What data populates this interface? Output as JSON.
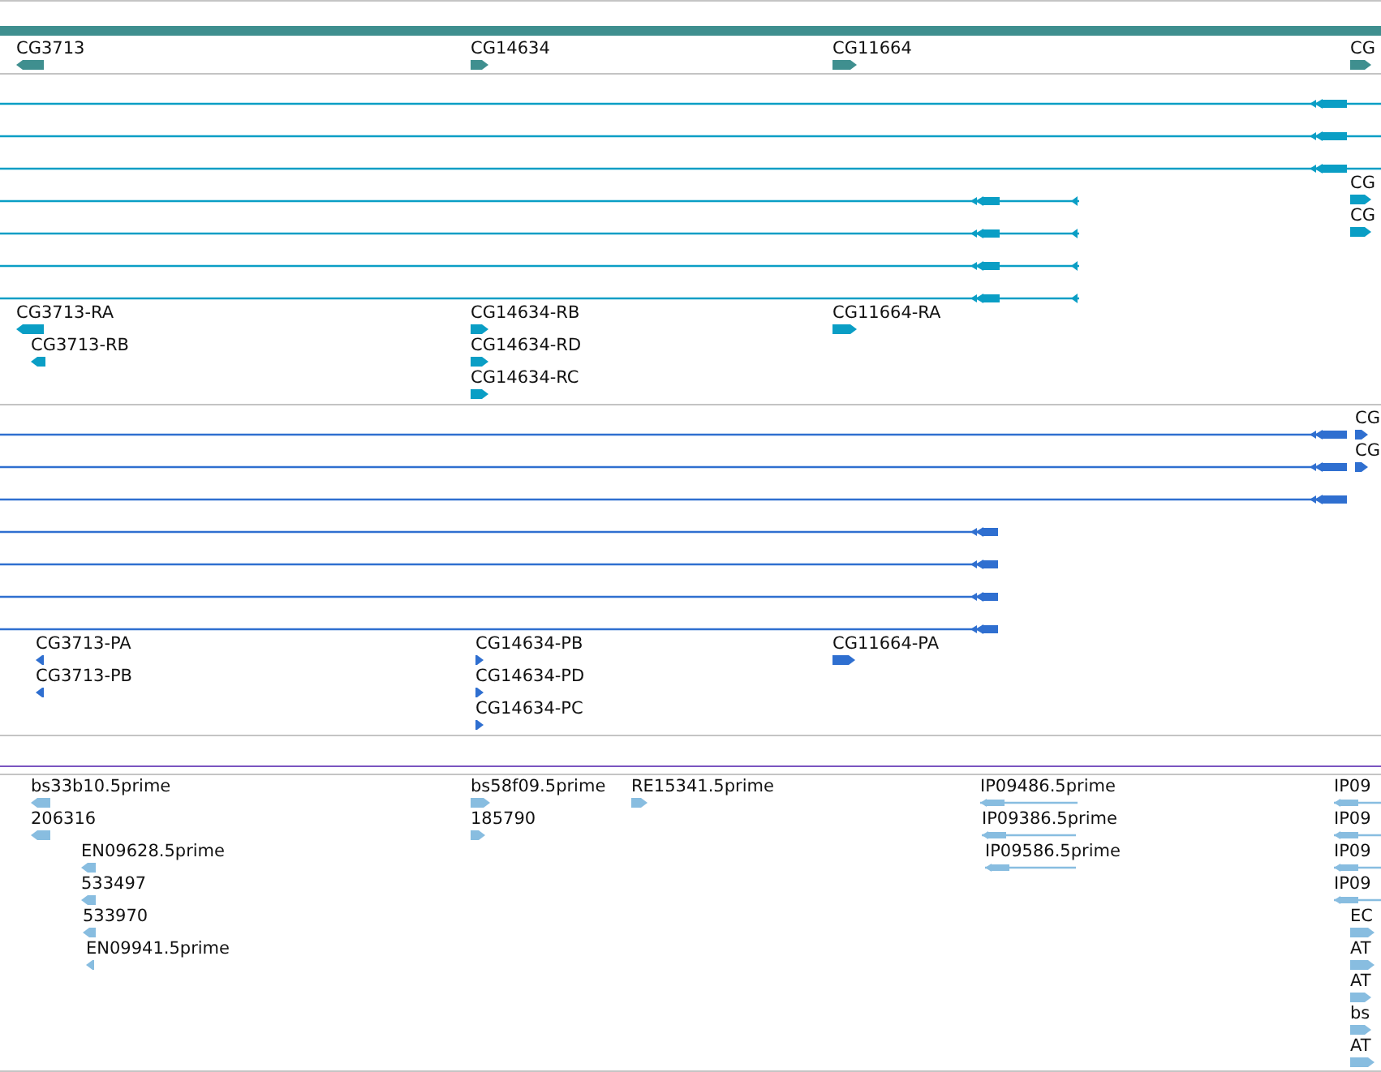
{
  "tracks": [
    {
      "kind": "gene",
      "features": [
        {
          "label": "CG3713",
          "reverse": true
        },
        {
          "label": "CG14634",
          "reverse": false
        },
        {
          "label": "CG11664",
          "reverse": false
        },
        {
          "label": "CG",
          "reverse": false
        }
      ]
    },
    {
      "kind": "transcript",
      "lines": [
        {
          "reverse": true
        },
        {
          "reverse": true
        },
        {
          "reverse": true
        },
        {
          "reverse": true
        },
        {
          "reverse": true
        },
        {
          "reverse": true
        },
        {
          "reverse": true
        }
      ],
      "features": [
        {
          "label": "CG",
          "reverse": false
        },
        {
          "label": "CG",
          "reverse": false
        },
        {
          "label": "CG3713-RA",
          "reverse": true
        },
        {
          "label": "CG3713-RB",
          "reverse": true
        },
        {
          "label": "CG14634-RB",
          "reverse": false
        },
        {
          "label": "CG14634-RD",
          "reverse": false
        },
        {
          "label": "CG14634-RC",
          "reverse": false
        },
        {
          "label": "CG11664-RA",
          "reverse": false
        }
      ]
    },
    {
      "kind": "protein",
      "lines": [
        {
          "reverse": true
        },
        {
          "reverse": true
        },
        {
          "reverse": true
        },
        {
          "reverse": true
        },
        {
          "reverse": true
        },
        {
          "reverse": true
        },
        {
          "reverse": true
        }
      ],
      "features": [
        {
          "label": "CG",
          "reverse": false
        },
        {
          "label": "CG",
          "reverse": false
        },
        {
          "label": "CG3713-PA",
          "reverse": true
        },
        {
          "label": "CG3713-PB",
          "reverse": true
        },
        {
          "label": "CG14634-PB",
          "reverse": false
        },
        {
          "label": "CG14634-PD",
          "reverse": false
        },
        {
          "label": "CG14634-PC",
          "reverse": false
        },
        {
          "label": "CG11664-PA",
          "reverse": false
        }
      ]
    },
    {
      "kind": "est",
      "features": [
        {
          "label": "bs33b10.5prime",
          "reverse": true,
          "kind": "block"
        },
        {
          "label": "bs58f09.5prime",
          "reverse": false,
          "kind": "block"
        },
        {
          "label": "RE15341.5prime",
          "reverse": false,
          "kind": "block"
        },
        {
          "label": "IP09486.5prime",
          "reverse": true,
          "kind": "spliced"
        },
        {
          "label": "IP09",
          "reverse": true,
          "kind": "spliced"
        },
        {
          "label": "206316",
          "reverse": true,
          "kind": "block"
        },
        {
          "label": "185790",
          "reverse": false,
          "kind": "block"
        },
        {
          "label": "IP09386.5prime",
          "reverse": true,
          "kind": "spliced"
        },
        {
          "label": "IP09",
          "reverse": true,
          "kind": "spliced"
        },
        {
          "label": "EN09628.5prime",
          "reverse": true,
          "kind": "block"
        },
        {
          "label": "IP09586.5prime",
          "reverse": true,
          "kind": "spliced"
        },
        {
          "label": "IP09",
          "reverse": true,
          "kind": "spliced"
        },
        {
          "label": "533497",
          "reverse": true,
          "kind": "block"
        },
        {
          "label": "IP09",
          "reverse": true,
          "kind": "spliced"
        },
        {
          "label": "533970",
          "reverse": true,
          "kind": "block"
        },
        {
          "label": "EC",
          "reverse": false,
          "kind": "block"
        },
        {
          "label": "EN09941.5prime",
          "reverse": true,
          "kind": "block"
        },
        {
          "label": "AT",
          "reverse": false,
          "kind": "block"
        },
        {
          "label": "AT",
          "reverse": false,
          "kind": "block"
        },
        {
          "label": "bs",
          "reverse": false,
          "kind": "block"
        },
        {
          "label": "AT",
          "reverse": false,
          "kind": "block"
        }
      ]
    }
  ]
}
